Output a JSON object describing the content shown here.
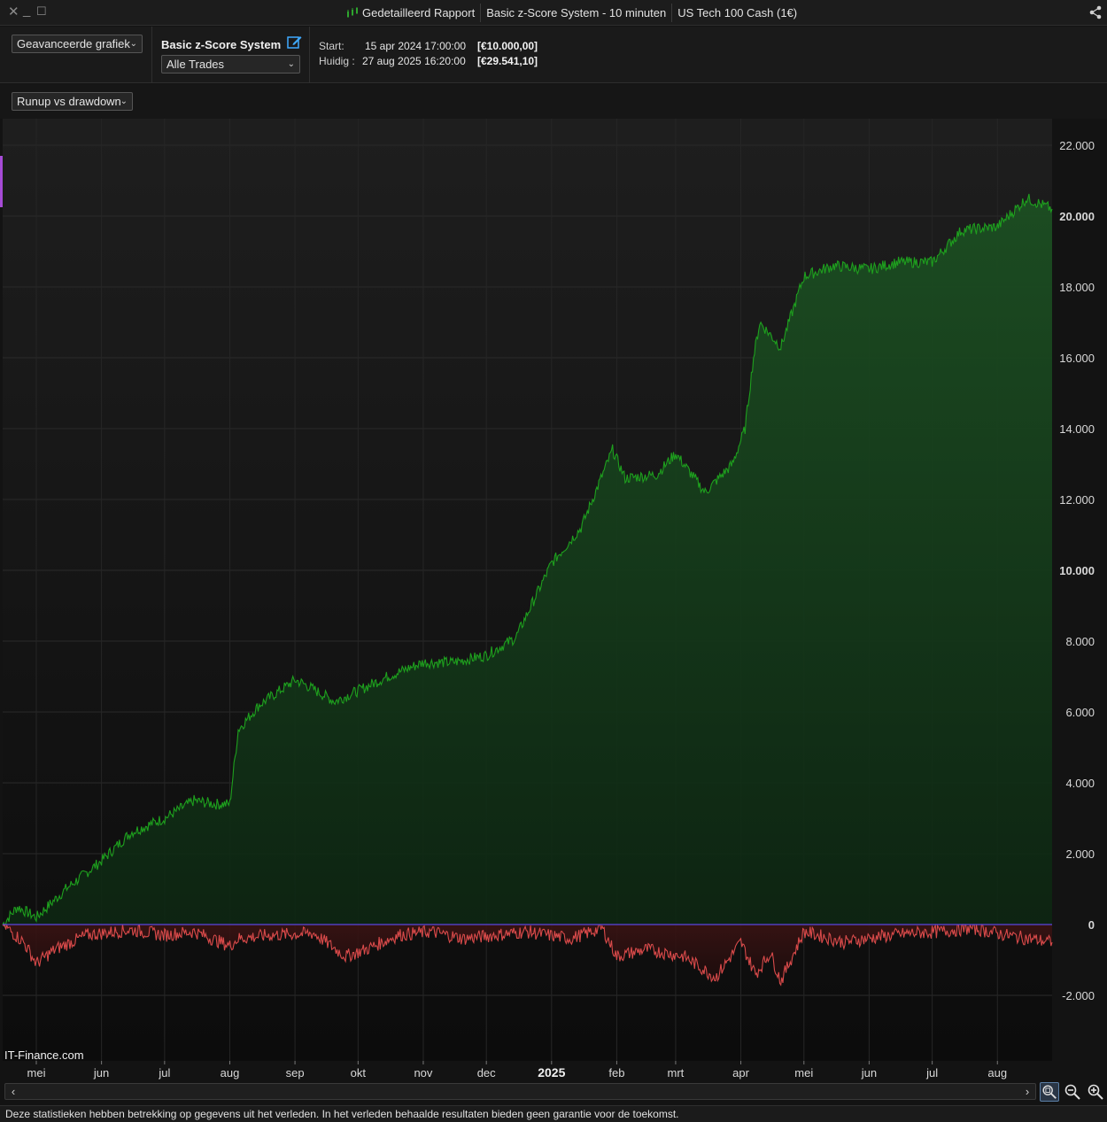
{
  "window": {
    "tabs": [
      "Gedetailleerd Rapport",
      "Basic z-Score System - 10 minuten",
      "US Tech 100 Cash (1€)"
    ]
  },
  "toolbar": {
    "view_select": "Geavanceerde grafiek",
    "system_name": "Basic z-Score System",
    "trades_select": "Alle Trades",
    "start_label": "Start:",
    "start_date": "15 apr 2024 17:00:00",
    "start_value": "[€10.000,00]",
    "current_label": "Huidig :",
    "current_date": "27 aug 2025 16:20:00",
    "current_value": "[€29.541,10]"
  },
  "chart_selector": "Runup vs drawdown",
  "watermark": "IT-Finance.com",
  "disclaimer": "Deze statistieken hebben betrekking op gegevens uit het verleden. In het verleden behaalde resultaten bieden geen garantie voor de toekomst.",
  "colors": {
    "runup_line": "#1ea01e",
    "runup_fill": "#0f3a16",
    "drawdown_line": "#d94a4a",
    "zero_line": "#5a45e0",
    "background": "#131313"
  },
  "chart_data": {
    "type": "area",
    "title": "",
    "xlabel": "",
    "ylabel": "",
    "ylim": [
      -3000,
      22500
    ],
    "grid": true,
    "y_ticks": [
      "22.000",
      "20.000",
      "18.000",
      "16.000",
      "14.000",
      "12.000",
      "10.000",
      "8.000",
      "6.000",
      "4.000",
      "2.000",
      "0",
      "-2.000"
    ],
    "y_ticks_bold": [
      "20.000",
      "10.000",
      "0"
    ],
    "x_ticks": [
      "mei",
      "jun",
      "jul",
      "aug",
      "sep",
      "okt",
      "nov",
      "dec",
      "2025",
      "feb",
      "mrt",
      "apr",
      "mei",
      "jun",
      "jul",
      "aug"
    ],
    "x_ticks_bold": [
      "2025"
    ],
    "x_range": [
      "2024-04-15",
      "2025-08-27"
    ],
    "series": [
      {
        "x": [
          "2024-04-15",
          "2024-04-22",
          "2024-05-01",
          "2024-05-15",
          "2024-06-01",
          "2024-06-15",
          "2024-07-01",
          "2024-07-15",
          "2024-07-25",
          "2024-08-01",
          "2024-08-05",
          "2024-08-15",
          "2024-09-01",
          "2024-09-05",
          "2024-09-20",
          "2024-10-01",
          "2024-10-15",
          "2024-11-01",
          "2024-11-15",
          "2024-12-01",
          "2024-12-15",
          "2025-01-01",
          "2025-01-15",
          "2025-01-30",
          "2025-02-05",
          "2025-02-20",
          "2025-03-01",
          "2025-03-15",
          "2025-03-28",
          "2025-04-03",
          "2025-04-07",
          "2025-04-10",
          "2025-04-20",
          "2025-05-01",
          "2025-05-15",
          "2025-06-01",
          "2025-06-15",
          "2025-07-01",
          "2025-07-15",
          "2025-08-01",
          "2025-08-15",
          "2025-08-27"
        ],
        "values": [
          0,
          500,
          200,
          1000,
          1800,
          2600,
          3000,
          3500,
          3400,
          3400,
          5500,
          6200,
          6900,
          6800,
          6300,
          6600,
          7000,
          7400,
          7400,
          7600,
          8100,
          10200,
          11200,
          13400,
          12600,
          12700,
          13300,
          12200,
          13000,
          14000,
          16000,
          17000,
          16300,
          18300,
          18600,
          18500,
          18700,
          18700,
          19600,
          19700,
          20500,
          20200
        ]
      },
      {
        "x": [
          "2024-04-15",
          "2024-04-25",
          "2024-05-01",
          "2024-05-10",
          "2024-05-25",
          "2024-06-15",
          "2024-07-01",
          "2024-07-15",
          "2024-08-01",
          "2024-08-05",
          "2024-08-20",
          "2024-09-10",
          "2024-09-25",
          "2024-10-05",
          "2024-10-20",
          "2024-11-05",
          "2024-11-20",
          "2024-12-05",
          "2024-12-20",
          "2025-01-10",
          "2025-01-25",
          "2025-02-01",
          "2025-02-15",
          "2025-03-05",
          "2025-03-20",
          "2025-04-01",
          "2025-04-08",
          "2025-04-15",
          "2025-04-20",
          "2025-05-01",
          "2025-05-20",
          "2025-06-05",
          "2025-06-20",
          "2025-07-05",
          "2025-07-20",
          "2025-08-05",
          "2025-08-27"
        ],
        "values": [
          0,
          -500,
          -1100,
          -700,
          -300,
          -150,
          -300,
          -200,
          -600,
          -400,
          -300,
          -250,
          -900,
          -700,
          -300,
          -200,
          -400,
          -300,
          -200,
          -400,
          -100,
          -900,
          -700,
          -900,
          -1500,
          -500,
          -1400,
          -800,
          -1600,
          -200,
          -500,
          -350,
          -250,
          -200,
          -100,
          -300,
          -500
        ]
      }
    ]
  }
}
